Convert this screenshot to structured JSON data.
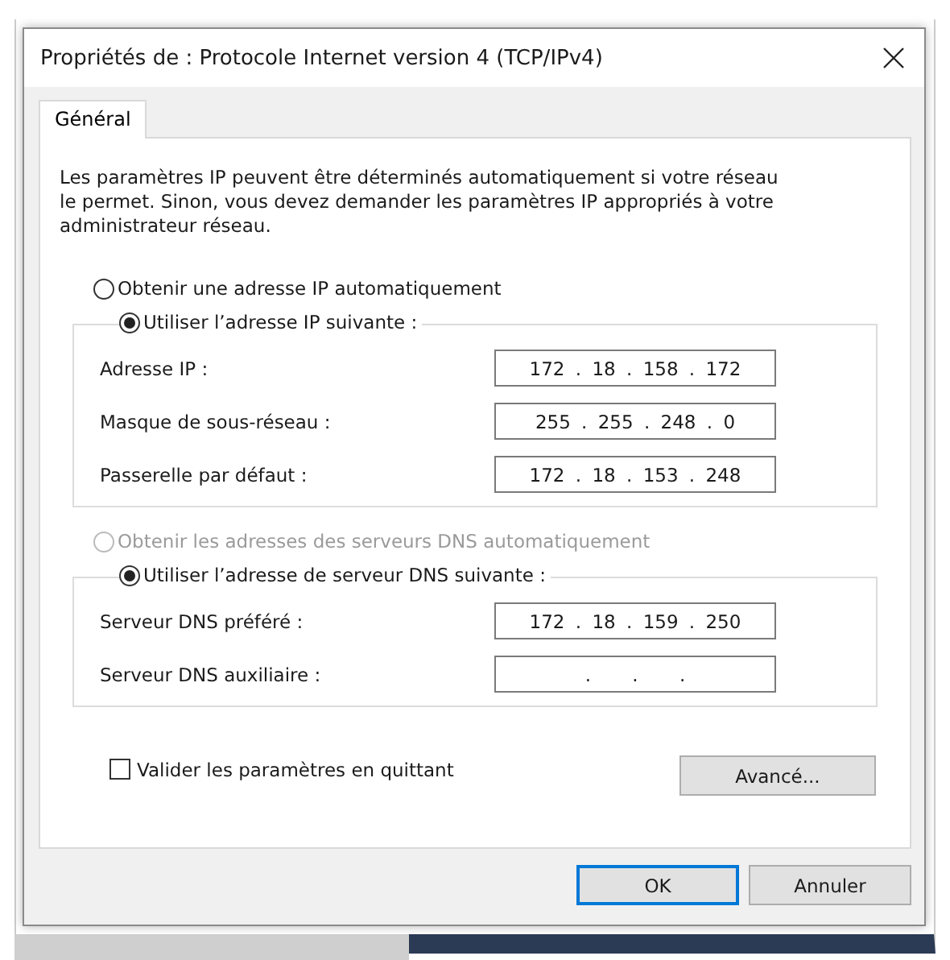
{
  "window": {
    "title": "Propriétés de : Protocole Internet version 4 (TCP/IPv4)"
  },
  "tabs": [
    {
      "label": "Général",
      "selected": true
    }
  ],
  "description": "Les paramètres IP peuvent être déterminés automatiquement si votre réseau le permet. Sinon, vous devez demander les paramètres IP appropriés à votre administrateur réseau.",
  "sections": [
    {
      "auto_option": {
        "label": "Obtenir une adresse IP automatiquement",
        "selected": false,
        "disabled": false
      },
      "manual_option": {
        "label": "Utiliser l’adresse IP suivante :",
        "selected": true,
        "disabled": false
      },
      "fields": [
        {
          "label": "Adresse IP :",
          "value": "172 . 18 . 158 . 172"
        },
        {
          "label": "Masque de sous-réseau :",
          "value": "255 . 255 . 248 . 0"
        },
        {
          "label": "Passerelle par défaut :",
          "value": "172 . 18 . 153 . 248"
        }
      ]
    },
    {
      "auto_option": {
        "label": "Obtenir les adresses des serveurs DNS automatiquement",
        "selected": false,
        "disabled": true
      },
      "manual_option": {
        "label": "Utiliser l’adresse de serveur DNS suivante :",
        "selected": true,
        "disabled": false
      },
      "fields": [
        {
          "label": "Serveur DNS préféré :",
          "value": "172 . 18 . 159 . 250"
        },
        {
          "label": "Serveur DNS auxiliaire :",
          "value": ". . ."
        }
      ]
    }
  ],
  "validate_checkbox": {
    "label": "Valider les paramètres en quittant",
    "checked": false
  },
  "advanced_button": "Avancé...",
  "buttons": [
    {
      "label": "OK",
      "default": true
    },
    {
      "label": "Annuler",
      "default": false
    }
  ]
}
